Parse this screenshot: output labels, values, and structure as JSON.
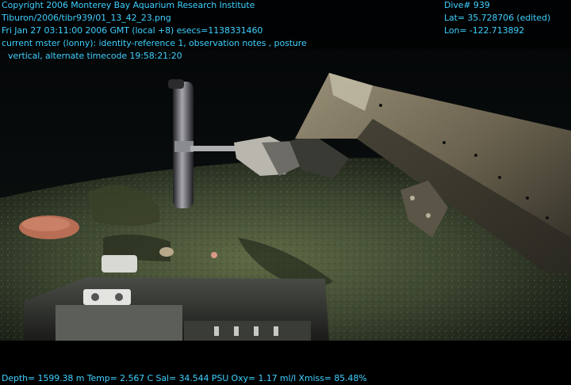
{
  "overlay": {
    "top_left": {
      "copyright": "Copyright 2006 Monterey Bay Aquarium Research Institute",
      "file": "Tiburon/2006/tibr939/01_13_42_23.png",
      "datetime": "Fri Jan 27 03:11:00 2006 GMT (local +8)  esecs=1138331460",
      "annotation_1": "current mster (lonny): identity-reference 1, observation notes , posture",
      "annotation_2": "vertical, alternate timecode 19:58:21:20"
    },
    "top_right": {
      "dive": "Dive# 939",
      "lat": "Lat= 35.728706 (edited)",
      "lon": "Lon= -122.713892"
    },
    "bottom": {
      "telemetry": "Depth= 1599.38 m  Temp= 2.567 C  Sal= 34.544 PSU  Oxy= 1.17 ml/l  Xmiss= 85.48%"
    },
    "text_color": "#3fd0ff"
  }
}
